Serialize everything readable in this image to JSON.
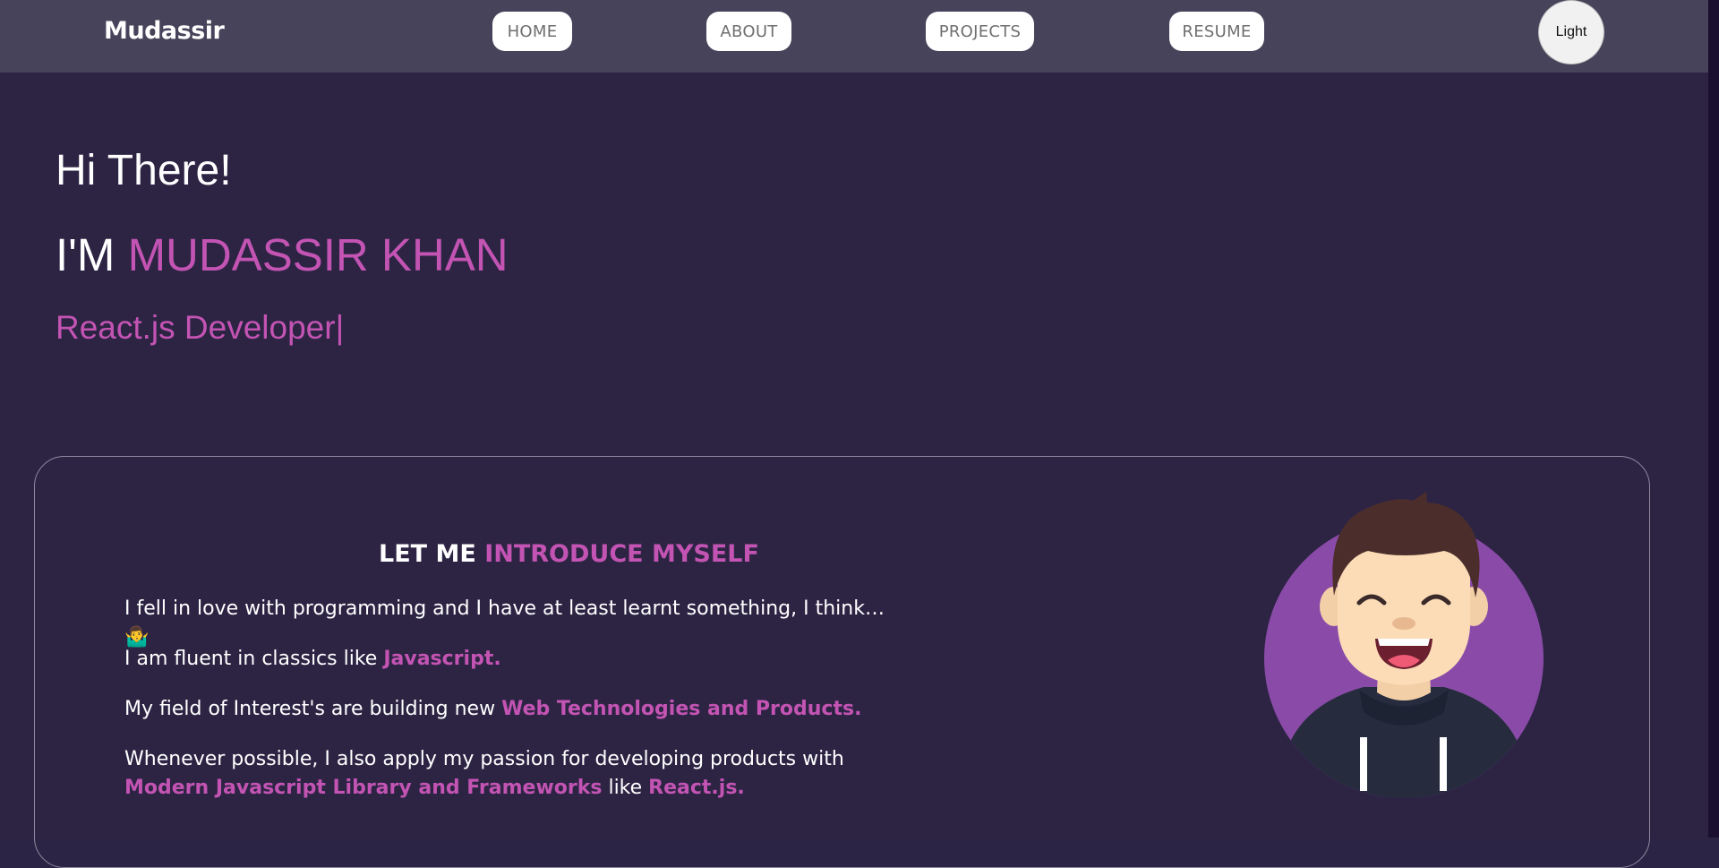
{
  "navbar": {
    "brand": "Mudassir",
    "items": [
      "HOME",
      "ABOUT",
      "PROJECTS",
      "RESUME"
    ],
    "theme_toggle": "Light"
  },
  "hero": {
    "greeting": "Hi There!",
    "name_prefix": "I'M ",
    "name": "MUDASSIR KHAN",
    "role": "React.js Developer|"
  },
  "about": {
    "title_prefix": "LET ME ",
    "title_accent": "INTRODUCE MYSELF",
    "p1_text": "I fell in love with programming and I have at least learnt something, I think… 🤷‍♂️",
    "p2_text": "I am fluent in classics like ",
    "p2_accent": "Javascript.",
    "p3_text": "My field of Interest's are building new ",
    "p3_accent": "Web Technologies and Products.",
    "p4_text": "Whenever possible, I also apply my passion for developing products with ",
    "p4_accent1": "Modern Javascript Library and Frameworks",
    "p4_mid": " like ",
    "p4_accent2": "React.js."
  },
  "colors": {
    "background": "#2d2444",
    "navbar": "#47435a",
    "accent": "#c354b3",
    "avatar_circle": "#8a4ba8"
  }
}
